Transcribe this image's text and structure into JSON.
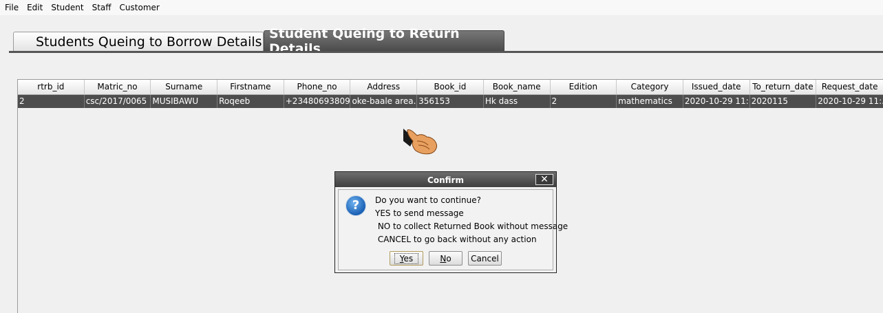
{
  "menu": [
    "File",
    "Edit",
    "Student",
    "Staff",
    "Customer"
  ],
  "tabs": {
    "borrow": "Students Queing to Borrow Details",
    "return": "Student Queing to Return Details",
    "active": "return"
  },
  "table": {
    "columns": [
      "rtrb_id",
      "Matric_no",
      "Surname",
      "Firstname",
      "Phone_no",
      "Address",
      "Book_id",
      "Book_name",
      "Edition",
      "Category",
      "Issued_date",
      "To_return_date",
      "Request_date"
    ],
    "rows": [
      [
        "2",
        "csc/2017/0065",
        "MUSIBAWU",
        "Roqeeb",
        "+23480693809...",
        "oke-baale area...",
        "356153",
        "Hk dass",
        "2",
        "mathematics",
        "2020-10-29 11:...",
        "2020115",
        "2020-10-29 11:..."
      ]
    ]
  },
  "dialog": {
    "title": "Confirm",
    "close_glyph": "✕",
    "icon": "question-icon",
    "icon_glyph": "?",
    "lines": [
      "Do you want to continue?",
      "YES to send message",
      " NO to collect Returned Book without message",
      " CANCEL to go back without any action"
    ],
    "buttons": {
      "yes_mnemonic": "Y",
      "yes_rest": "es",
      "no_mnemonic": "N",
      "no_rest": "o",
      "cancel": "Cancel"
    }
  },
  "colors": {
    "selected_row": "#4d4d4d",
    "active_tab": "#555555",
    "question_icon": "#1a5fb4"
  }
}
